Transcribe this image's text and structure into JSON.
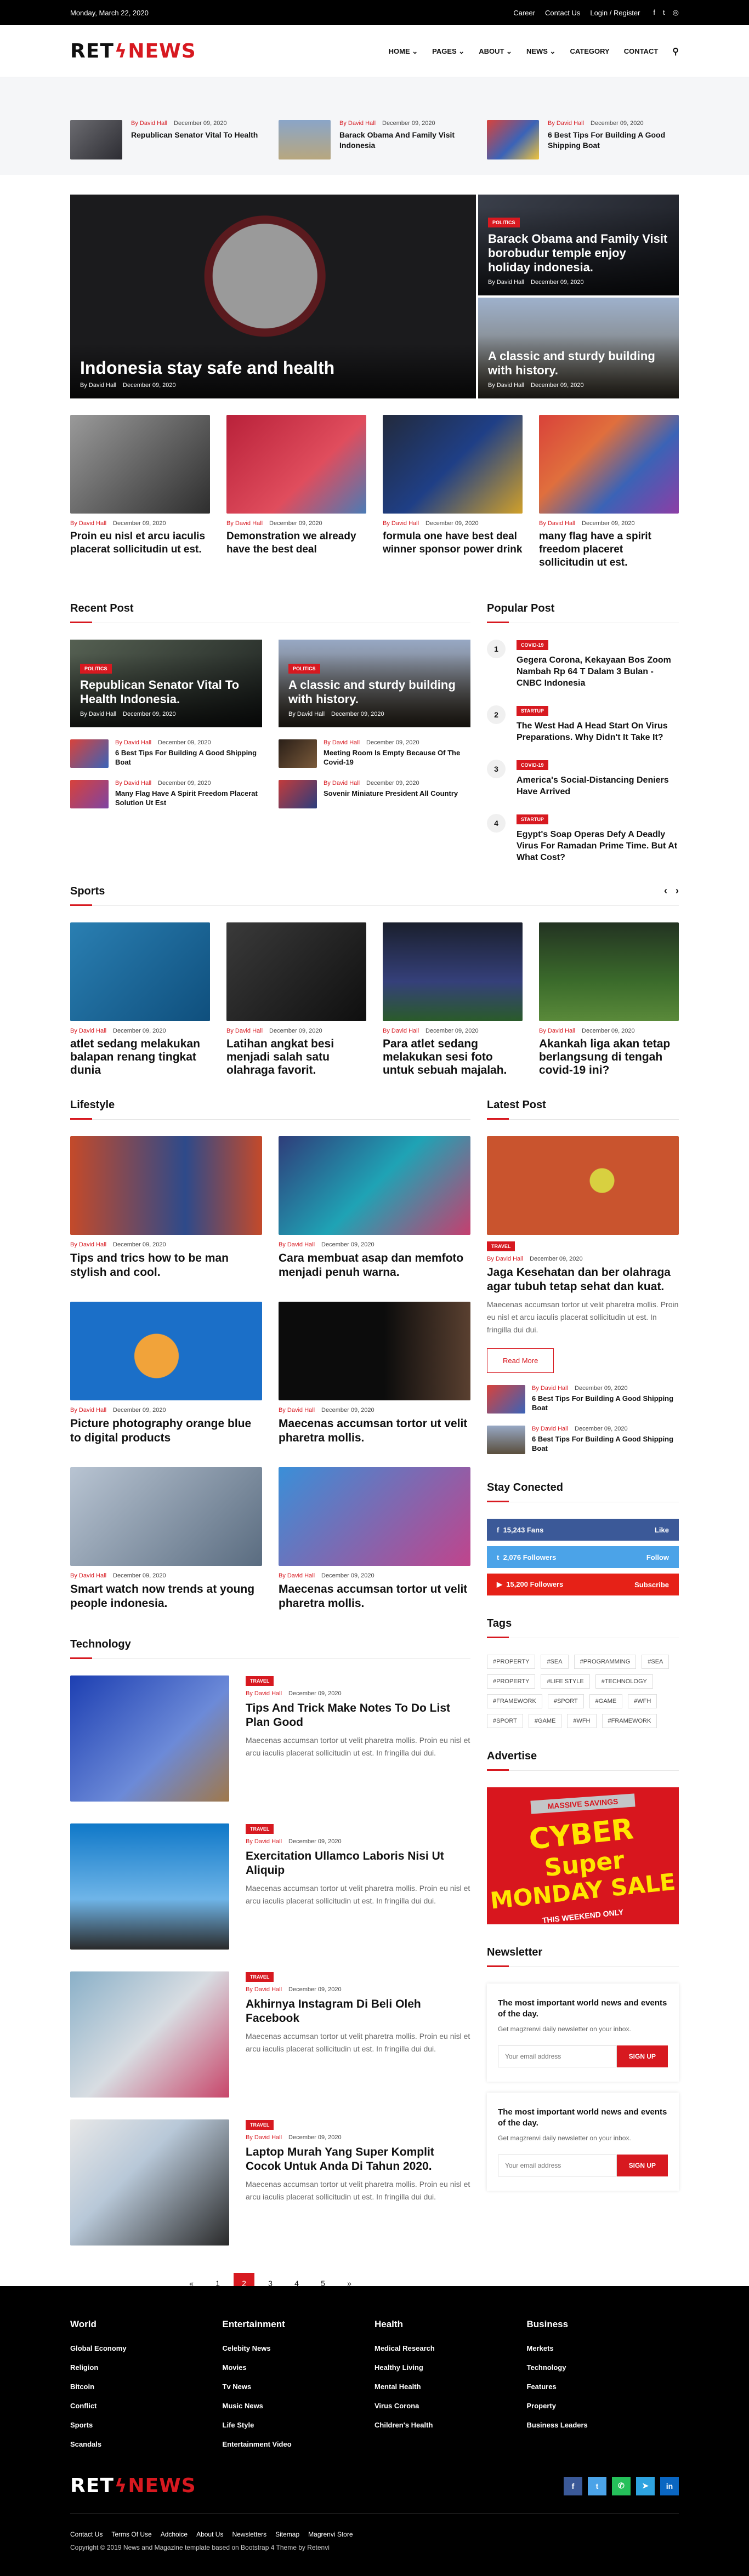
{
  "topbar": {
    "date": "Monday, March 22, 2020",
    "links": [
      "Career",
      "Contact Us",
      "Login / Register"
    ]
  },
  "logo": {
    "part1": "RET",
    "part2": "NEWS"
  },
  "nav": {
    "items": [
      "HOME",
      "PAGES",
      "ABOUT",
      "NEWS",
      "CATEGORY",
      "CONTACT"
    ]
  },
  "ticker": [
    {
      "author": "By David Hall",
      "date": "December 09, 2020",
      "title": "Republican Senator Vital To Health"
    },
    {
      "author": "By David Hall",
      "date": "December 09, 2020",
      "title": "Barack Obama And Family Visit Indonesia"
    },
    {
      "author": "By David Hall",
      "date": "December 09, 2020",
      "title": "6 Best Tips For Building A Good Shipping Boat"
    }
  ],
  "hero": {
    "main": {
      "title": "Indonesia stay safe and health",
      "author": "By David Hall",
      "date": "December 09, 2020"
    },
    "side": [
      {
        "badge": "POLITICS",
        "title": "Barack Obama and Family Visit borobudur temple enjoy holiday indonesia.",
        "author": "By David Hall",
        "date": "December 09, 2020"
      },
      {
        "title": "A classic and sturdy building with history.",
        "author": "By David Hall",
        "date": "December 09, 2020"
      }
    ]
  },
  "row4": [
    {
      "author": "By David Hall",
      "date": "December 09, 2020",
      "title": "Proin eu nisl et arcu iaculis placerat sollicitudin ut est."
    },
    {
      "author": "By David Hall",
      "date": "December 09, 2020",
      "title": "Demonstration we already have the best deal"
    },
    {
      "author": "By David Hall",
      "date": "December 09, 2020",
      "title": "formula one have best deal winner sponsor power drink"
    },
    {
      "author": "By David Hall",
      "date": "December 09, 2020",
      "title": "many flag have a spirit freedom placeret sollicitudin ut est."
    }
  ],
  "recent": {
    "heading": "Recent Post",
    "big": [
      {
        "badge": "POLITICS",
        "title": "Republican Senator Vital To Health Indonesia.",
        "author": "By David Hall",
        "date": "December 09, 2020"
      },
      {
        "badge": "POLITICS",
        "title": "A classic and sturdy building with history.",
        "author": "By David Hall",
        "date": "December 09, 2020"
      }
    ],
    "small": [
      {
        "author": "By David Hall",
        "date": "December 09, 2020",
        "title": "6 Best Tips For Building A Good Shipping Boat"
      },
      {
        "author": "By David Hall",
        "date": "December 09, 2020",
        "title": "Meeting Room Is Empty Because Of The Covid-19"
      },
      {
        "author": "By David Hall",
        "date": "December 09, 2020",
        "title": "Many Flag Have A Spirit Freedom Placerat Solution Ut Est"
      },
      {
        "author": "By David Hall",
        "date": "December 09, 2020",
        "title": "Sovenir Miniature President All Country"
      }
    ]
  },
  "popular": {
    "heading": "Popular Post",
    "items": [
      {
        "num": "1",
        "badge": "COVID-19",
        "title": "Gegera Corona, Kekayaan Bos Zoom Nambah Rp 64 T Dalam 3 Bulan - CNBC Indonesia"
      },
      {
        "num": "2",
        "badge": "STARTUP",
        "title": "The West Had A Head Start On Virus Preparations. Why Didn't It Take It?"
      },
      {
        "num": "3",
        "badge": "COVID-19",
        "title": "America's Social-Distancing Deniers Have Arrived"
      },
      {
        "num": "4",
        "badge": "STARTUP",
        "title": "Egypt's Soap Operas Defy A Deadly Virus For Ramadan Prime Time. But At What Cost?"
      }
    ]
  },
  "sports": {
    "heading": "Sports",
    "items": [
      {
        "author": "By David Hall",
        "date": "December 09, 2020",
        "title": "atlet sedang melakukan balapan renang tingkat dunia"
      },
      {
        "author": "By David Hall",
        "date": "December 09, 2020",
        "title": "Latihan angkat besi menjadi salah satu olahraga favorit."
      },
      {
        "author": "By David Hall",
        "date": "December 09, 2020",
        "title": "Para atlet sedang melakukan sesi foto untuk sebuah majalah."
      },
      {
        "author": "By David Hall",
        "date": "December 09, 2020",
        "title": "Akankah liga akan tetap berlangsung di tengah covid-19 ini?"
      }
    ]
  },
  "lifestyle": {
    "heading": "Lifestyle",
    "items": [
      {
        "author": "By David Hall",
        "date": "December 09, 2020",
        "title": "Tips and trics how to be man stylish and cool."
      },
      {
        "author": "By David Hall",
        "date": "December 09, 2020",
        "title": "Cara membuat asap dan memfoto menjadi penuh warna."
      },
      {
        "author": "By David Hall",
        "date": "December 09, 2020",
        "title": "Picture photography orange blue to digital products"
      },
      {
        "author": "By David Hall",
        "date": "December 09, 2020",
        "title": "Maecenas accumsan tortor ut velit pharetra mollis."
      },
      {
        "author": "By David Hall",
        "date": "December 09, 2020",
        "title": "Smart watch now trends at young people indonesia."
      },
      {
        "author": "By David Hall",
        "date": "December 09, 2020",
        "title": "Maecenas accumsan tortor ut velit pharetra mollis."
      }
    ]
  },
  "latest": {
    "heading": "Latest Post",
    "big": {
      "badge": "TRAVEL",
      "author": "By David Hall",
      "date": "December 09, 2020",
      "title": "Jaga Kesehatan dan ber olahraga agar tubuh tetap sehat dan kuat.",
      "excerpt": "Maecenas accumsan tortor ut velit pharetra mollis. Proin eu nisl et arcu iaculis placerat sollicitudin ut est. In fringilla dui dui.",
      "button": "Read More"
    },
    "small": [
      {
        "author": "By David Hall",
        "date": "December 09, 2020",
        "title": "6 Best Tips For Building A Good Shipping Boat"
      },
      {
        "author": "By David Hall",
        "date": "December 09, 2020",
        "title": "6 Best Tips For Building A Good Shipping Boat"
      }
    ]
  },
  "stay": {
    "heading": "Stay Conected",
    "rows": [
      {
        "icon": "f",
        "count": "15,243 Fans",
        "action": "Like",
        "color": "#3b5998"
      },
      {
        "icon": "t",
        "count": "2,076 Followers",
        "action": "Follow",
        "color": "#4ba3e8"
      },
      {
        "icon": "▶",
        "count": "15,200 Followers",
        "action": "Subscribe",
        "color": "#e62117"
      }
    ]
  },
  "tags": {
    "heading": "Tags",
    "items": [
      "#PROPERTY",
      "#SEA",
      "#PROGRAMMING",
      "#SEA",
      "#PROPERTY",
      "#LIFE STYLE",
      "#TECHNOLOGY",
      "#FRAMEWORK",
      "#SPORT",
      "#GAME",
      "#WFH",
      "#SPORT",
      "#GAME",
      "#WFH",
      "#FRAMEWORK"
    ]
  },
  "advertise": {
    "heading": "Advertise",
    "top": "MASSIVE SAVINGS",
    "big1": "CYBER",
    "big2": "Super",
    "big3": "MONDAY",
    "big4": "SALE",
    "sub": "THIS WEEKEND ONLY"
  },
  "newsletter": {
    "heading": "Newsletter",
    "boxes": [
      {
        "title": "The most important world news and events of the day.",
        "sub": "Get magzrenvi daily newsletter on your inbox.",
        "placeholder": "Your email address",
        "button": "SIGN UP"
      },
      {
        "title": "The most important world news and events of the day.",
        "sub": "Get magzrenvi daily newsletter on your inbox.",
        "placeholder": "Your email address",
        "button": "SIGN UP"
      }
    ]
  },
  "technology": {
    "heading": "Technology",
    "items": [
      {
        "badge": "TRAVEL",
        "author": "By David Hall",
        "date": "December 09, 2020",
        "title": "Tips And Trick Make Notes To Do List Plan Good",
        "excerpt": "Maecenas accumsan tortor ut velit pharetra mollis. Proin eu nisl et arcu iaculis placerat sollicitudin ut est. In fringilla dui dui."
      },
      {
        "badge": "TRAVEL",
        "author": "By David Hall",
        "date": "December 09, 2020",
        "title": "Exercitation Ullamco Laboris Nisi Ut Aliquip",
        "excerpt": "Maecenas accumsan tortor ut velit pharetra mollis. Proin eu nisl et arcu iaculis placerat sollicitudin ut est. In fringilla dui dui."
      },
      {
        "badge": "TRAVEL",
        "author": "By David Hall",
        "date": "December 09, 2020",
        "title": "Akhirnya Instagram Di Beli Oleh Facebook",
        "excerpt": "Maecenas accumsan tortor ut velit pharetra mollis. Proin eu nisl et arcu iaculis placerat sollicitudin ut est. In fringilla dui dui."
      },
      {
        "badge": "TRAVEL",
        "author": "By David Hall",
        "date": "December 09, 2020",
        "title": "Laptop Murah Yang Super Komplit Cocok Untuk Anda Di Tahun 2020.",
        "excerpt": "Maecenas accumsan tortor ut velit pharetra mollis. Proin eu nisl et arcu iaculis placerat sollicitudin ut est. In fringilla dui dui."
      }
    ]
  },
  "pager": [
    "«",
    "1",
    "2",
    "3",
    "4",
    "5",
    "»"
  ],
  "footer": {
    "cols": [
      {
        "title": "World",
        "items": [
          "Global Economy",
          "Religion",
          "Bitcoin",
          "Conflict",
          "Sports",
          "Scandals"
        ]
      },
      {
        "title": "Entertainment",
        "items": [
          "Celebity News",
          "Movies",
          "Tv News",
          "Music News",
          "Life Style",
          "Entertainment Video"
        ]
      },
      {
        "title": "Health",
        "items": [
          "Medical Research",
          "Healthy Living",
          "Mental Health",
          "Virus Corona",
          "Children's Health"
        ]
      },
      {
        "title": "Business",
        "items": [
          "Merkets",
          "Technology",
          "Features",
          "Property",
          "Business Leaders"
        ]
      }
    ],
    "links": [
      "Contact Us",
      "Terms Of Use",
      "Adchoice",
      "About Us",
      "Newsletters",
      "Sitemap",
      "Magrenvi Store"
    ],
    "copy": "Copyright © 2019 News and Magazine template based on Bootstrap 4 Theme by Retenvi"
  }
}
